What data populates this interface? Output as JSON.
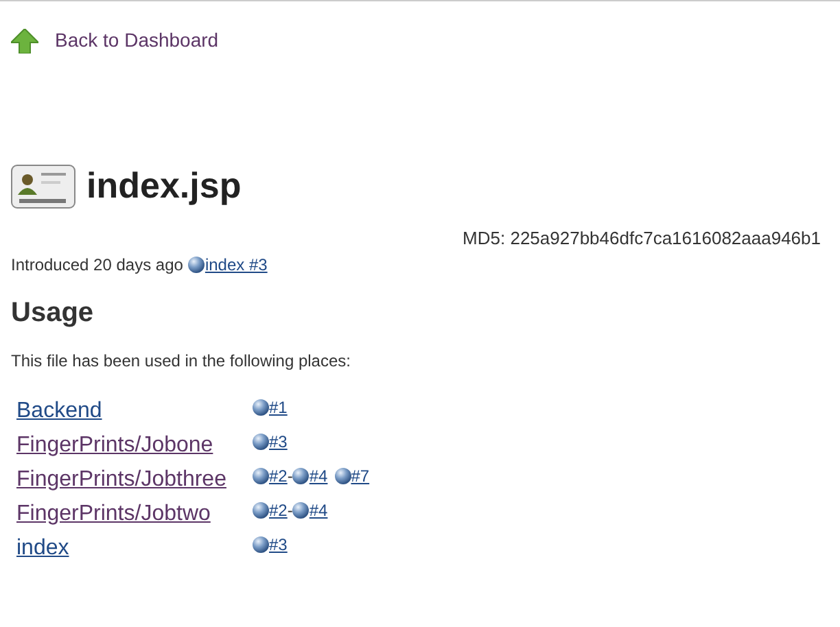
{
  "back_link": {
    "label": "Back to Dashboard"
  },
  "title": "index.jsp",
  "md5": "MD5: 225a927bb46dfc7ca1616082aaa946b1",
  "introduced": {
    "text": "Introduced 20 days ago",
    "build": "index #3"
  },
  "usage": {
    "heading": "Usage",
    "description": "This file has been used in the following places:",
    "rows": [
      {
        "job": "Backend",
        "visited": false,
        "builds": [
          {
            "kind": "build",
            "label": "#1"
          }
        ]
      },
      {
        "job": "FingerPrints/Jobone",
        "visited": true,
        "builds": [
          {
            "kind": "build",
            "label": "#3"
          }
        ]
      },
      {
        "job": "FingerPrints/Jobthree",
        "visited": true,
        "builds": [
          {
            "kind": "build",
            "label": "#2"
          },
          {
            "kind": "sep",
            "text": "-"
          },
          {
            "kind": "build",
            "label": "#4"
          },
          {
            "kind": "build",
            "label": "#7"
          }
        ]
      },
      {
        "job": "FingerPrints/Jobtwo",
        "visited": true,
        "builds": [
          {
            "kind": "build",
            "label": "#2"
          },
          {
            "kind": "sep",
            "text": "-"
          },
          {
            "kind": "build",
            "label": "#4"
          }
        ]
      },
      {
        "job": "index",
        "visited": false,
        "builds": [
          {
            "kind": "build",
            "label": "#3"
          }
        ]
      }
    ]
  }
}
